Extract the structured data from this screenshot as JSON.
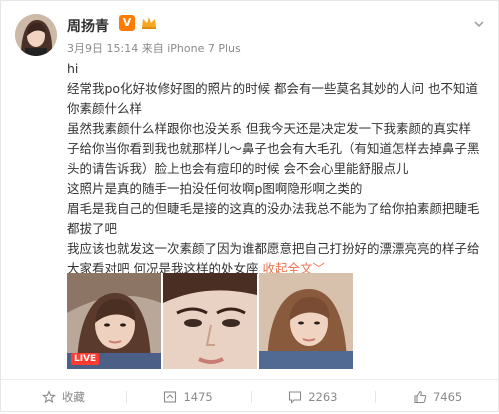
{
  "user": {
    "name": "周扬青",
    "vip_badge": "V",
    "time": "3月9日 15:14",
    "source_prefix": "来自",
    "source": "iPhone 7 Plus"
  },
  "post": {
    "paragraphs": [
      "hi",
      "经常我po化好妆修好图的照片的时候 都会有一些莫名其妙的人问 也不知道你素颜什么样",
      "虽然我素颜什么样跟你也没关系 但我今天还是决定发一下我素颜的真实样子给你当你看到我也就那样儿～鼻子也会有大毛孔（有知道怎样去掉鼻子黑头的请告诉我）脸上也会有痘印的时候 会不会心里能舒服点儿",
      "这照片是真的随手一拍没任何妆啊p图啊隐形啊之类的",
      "眉毛是我自己的但睫毛是接的这真的没办法我总不能为了给你拍素颜把睫毛都拔了吧",
      "我应该也就发这一次素颜了因为谁都愿意把自己打扮好的漂漂亮亮的样子给大家看对吧 何况是我这样的处女座"
    ],
    "collapse_label": "收起全文",
    "collapse_suffix": "﹀"
  },
  "images": {
    "live_label": "LIVE"
  },
  "actions": {
    "favorite": "收藏",
    "repost": "1475",
    "comment": "2263",
    "like": "7465"
  },
  "colors": {
    "link": "#eb7350",
    "vip": "#ff7a00",
    "muted": "#8a8a8a"
  }
}
